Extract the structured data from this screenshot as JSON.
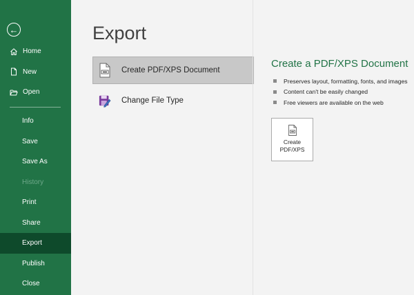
{
  "sidebar": {
    "back_icon": "back-arrow-icon",
    "top_items": [
      {
        "label": "Home",
        "icon": "home-icon"
      },
      {
        "label": "New",
        "icon": "new-document-icon"
      },
      {
        "label": "Open",
        "icon": "open-folder-icon"
      }
    ],
    "bottom_items": [
      {
        "label": "Info",
        "state": "normal"
      },
      {
        "label": "Save",
        "state": "normal"
      },
      {
        "label": "Save As",
        "state": "normal"
      },
      {
        "label": "History",
        "state": "disabled"
      },
      {
        "label": "Print",
        "state": "normal"
      },
      {
        "label": "Share",
        "state": "normal"
      },
      {
        "label": "Export",
        "state": "active"
      },
      {
        "label": "Publish",
        "state": "normal"
      },
      {
        "label": "Close",
        "state": "normal"
      }
    ]
  },
  "main": {
    "title": "Export",
    "options": [
      {
        "label": "Create PDF/XPS Document",
        "icon": "pdf-document-icon",
        "selected": true
      },
      {
        "label": "Change File Type",
        "icon": "change-file-type-icon",
        "selected": false
      }
    ],
    "detail": {
      "title": "Create a PDF/XPS Document",
      "bullets": [
        "Preserves layout, formatting, fonts, and images",
        "Content can't be easily changed",
        "Free viewers are available on the web"
      ],
      "button_line1": "Create",
      "button_line2": "PDF/XPS"
    }
  },
  "colors": {
    "sidebar_bg": "#217346",
    "sidebar_active": "#0e4a2b",
    "accent_text": "#217346",
    "main_bg": "#f3f3f3"
  }
}
